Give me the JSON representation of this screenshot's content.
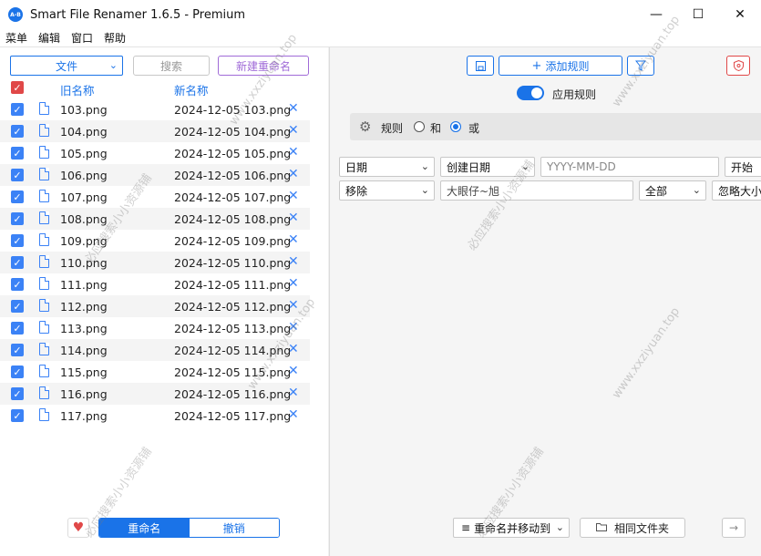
{
  "app": {
    "logo": "A-B",
    "title": "Smart File Renamer 1.6.5 - Premium"
  },
  "window": {
    "minimize": "—",
    "maximize": "☐",
    "close": "✕"
  },
  "menu": [
    "菜单",
    "编辑",
    "窗口",
    "帮助"
  ],
  "left": {
    "type_select": "文件",
    "search_label": "搜索",
    "new_rename_label": "新建重命名",
    "col_old": "旧名称",
    "col_new": "新名称",
    "rows": [
      {
        "old": "103.png",
        "new": "2024-12-05 103.png"
      },
      {
        "old": "104.png",
        "new": "2024-12-05 104.png"
      },
      {
        "old": "105.png",
        "new": "2024-12-05 105.png"
      },
      {
        "old": "106.png",
        "new": "2024-12-05 106.png"
      },
      {
        "old": "107.png",
        "new": "2024-12-05 107.png"
      },
      {
        "old": "108.png",
        "new": "2024-12-05 108.png"
      },
      {
        "old": "109.png",
        "new": "2024-12-05 109.png"
      },
      {
        "old": "110.png",
        "new": "2024-12-05 110.png"
      },
      {
        "old": "111.png",
        "new": "2024-12-05 111.png"
      },
      {
        "old": "112.png",
        "new": "2024-12-05 112.png"
      },
      {
        "old": "113.png",
        "new": "2024-12-05 113.png"
      },
      {
        "old": "114.png",
        "new": "2024-12-05 114.png"
      },
      {
        "old": "115.png",
        "new": "2024-12-05 115.png"
      },
      {
        "old": "116.png",
        "new": "2024-12-05 116.png"
      },
      {
        "old": "117.png",
        "new": "2024-12-05 117.png"
      }
    ],
    "rename_label": "重命名",
    "undo_label": "撤销"
  },
  "right": {
    "add_rule_label": "添加规则",
    "apply_rules_label": "应用规则",
    "rules_label": "规则",
    "and_label": "和",
    "or_label": "或",
    "rule1": {
      "type": "日期",
      "source": "创建日期",
      "format_placeholder": "YYYY-MM-DD",
      "position": "开始"
    },
    "rule2": {
      "type": "移除",
      "text": "大眼仔~旭",
      "scope": "全部",
      "case": "忽略大小"
    },
    "rename_move_label": "重命名并移动到",
    "same_folder_label": "相同文件夹"
  },
  "watermarks": [
    "www.xxziyuan.top",
    "必应搜索小小资源铺"
  ],
  "colors": {
    "accent": "#1a73e8",
    "purple": "#a06bd8",
    "danger": "#e04848"
  }
}
